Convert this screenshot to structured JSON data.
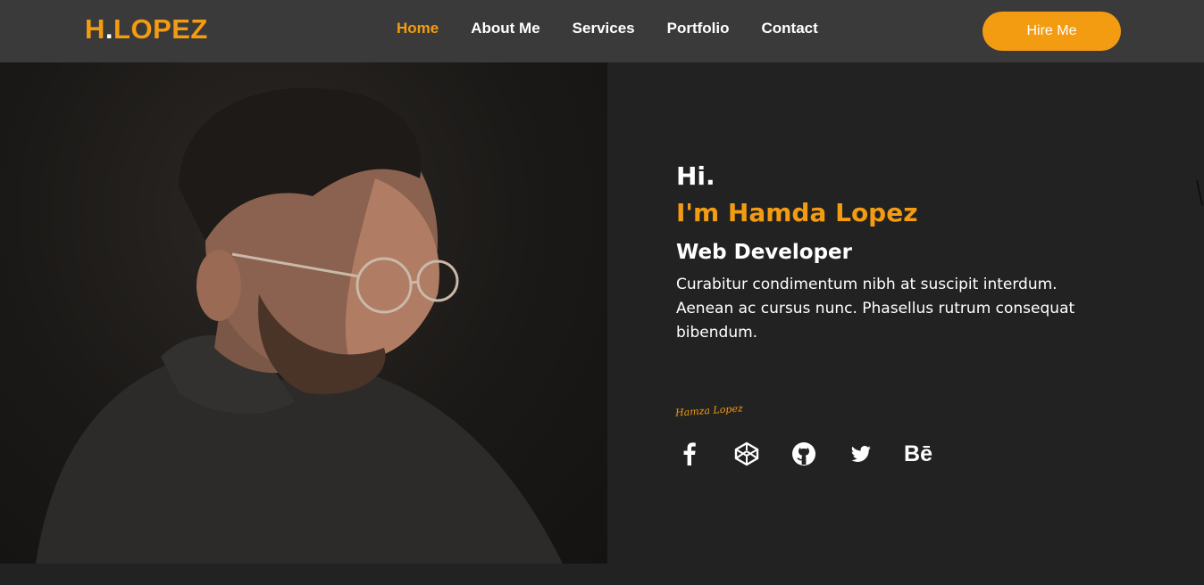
{
  "header": {
    "logo_first": "H",
    "logo_dot": ".",
    "logo_rest": "LOPEZ",
    "nav": [
      {
        "label": "Home",
        "active": true
      },
      {
        "label": "About Me",
        "active": false
      },
      {
        "label": "Services",
        "active": false
      },
      {
        "label": "Portfolio",
        "active": false
      },
      {
        "label": "Contact",
        "active": false
      }
    ],
    "hire_label": "Hire Me"
  },
  "hero": {
    "greeting": "Hi.",
    "name": "I'm Hamda Lopez",
    "role": "Web Developer",
    "bio": "Curabitur condimentum nibh at suscipit interdum. Aenean ac cursus nunc. Phasellus rutrum consequat bibendum.",
    "signature": "Hamza Lopez",
    "socials": [
      {
        "icon": "facebook-icon"
      },
      {
        "icon": "codepen-icon"
      },
      {
        "icon": "github-icon"
      },
      {
        "icon": "twitter-icon"
      },
      {
        "icon": "behance-icon",
        "text": "Bē"
      }
    ]
  },
  "colors": {
    "accent": "#f39c12",
    "navbar": "#3a3a3a",
    "background": "#222222",
    "text": "#ffffff"
  }
}
